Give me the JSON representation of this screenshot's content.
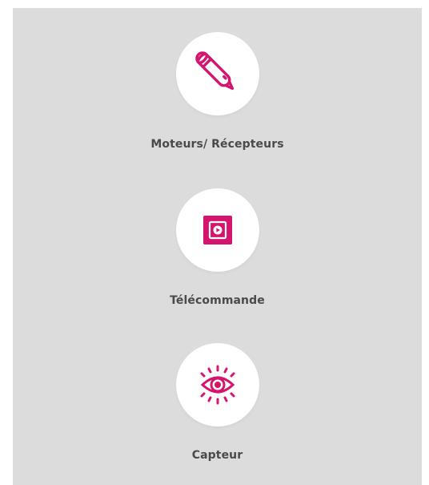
{
  "accent_color": "#d4146e",
  "categories": [
    {
      "label": "Moteurs/ Récepteurs",
      "icon": "motor-tube-icon"
    },
    {
      "label": "Télécommande",
      "icon": "remote-control-icon"
    },
    {
      "label": "Capteur",
      "icon": "eye-sensor-icon"
    }
  ]
}
